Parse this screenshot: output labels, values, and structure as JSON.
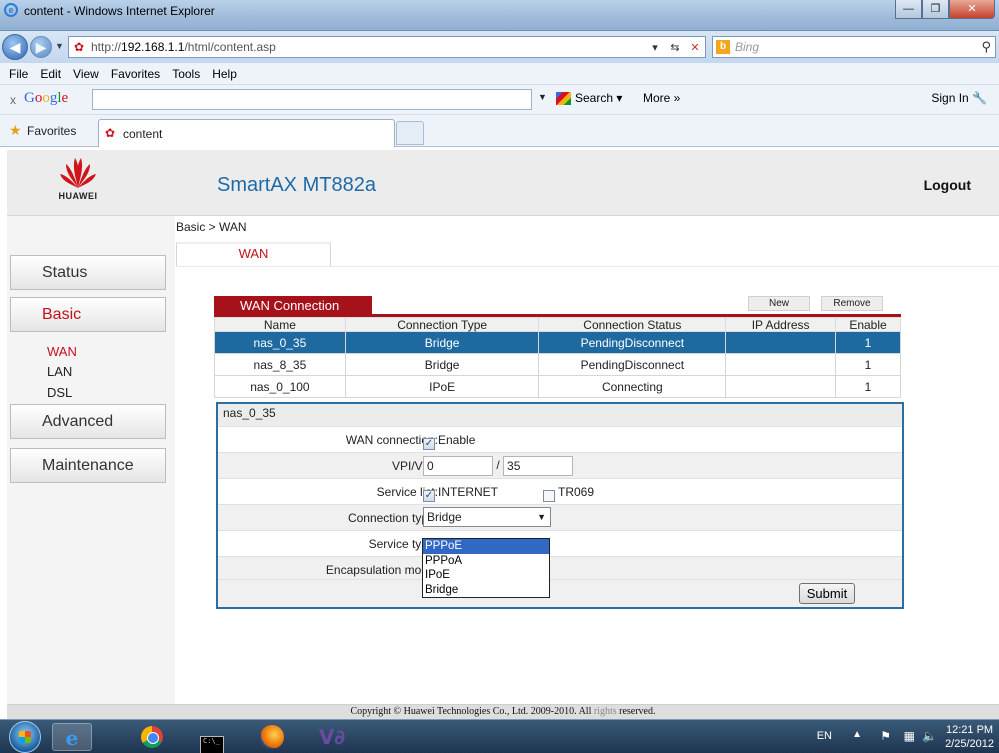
{
  "window": {
    "title": "content - Windows Internet Explorer"
  },
  "address": {
    "url_prefix": "http://",
    "url_host": "192.168.1.1",
    "url_path": "/html/content.asp",
    "search_placeholder": "Bing"
  },
  "menu": [
    "File",
    "Edit",
    "View",
    "Favorites",
    "Tools",
    "Help"
  ],
  "google_bar": {
    "close": "x",
    "search_label": "Search",
    "more_label": "More »",
    "sign_in": "Sign In"
  },
  "favorites_bar": {
    "favorites_label": "Favorites",
    "tab_label": "content"
  },
  "header": {
    "brand": "HUAWEI",
    "product": "SmartAX MT882a",
    "logout": "Logout"
  },
  "sidebar": {
    "status": "Status",
    "basic": "Basic",
    "basic_items": [
      "WAN",
      "LAN",
      "DSL"
    ],
    "advanced": "Advanced",
    "maintenance": "Maintenance"
  },
  "breadcrumb": "Basic > WAN",
  "tab": "WAN",
  "wan_table": {
    "title": "WAN Connection",
    "new_label": "New",
    "remove_label": "Remove",
    "columns": [
      "Name",
      "Connection Type",
      "Connection Status",
      "IP Address",
      "Enable"
    ],
    "rows": [
      [
        "nas_0_35",
        "Bridge",
        "PendingDisconnect",
        "",
        "1"
      ],
      [
        "nas_8_35",
        "Bridge",
        "PendingDisconnect",
        "",
        "1"
      ],
      [
        "nas_0_100",
        "IPoE",
        "Connecting",
        "",
        "1"
      ]
    ]
  },
  "detail": {
    "name": "nas_0_35",
    "wan_connection_label": "WAN connection:",
    "enable_label": "Enable",
    "vpi_vci_label": "VPI/VCI:",
    "vpi": "0",
    "slash": "/",
    "vci": "35",
    "service_list_label": "Service list:",
    "service_internet": "INTERNET",
    "service_tr069": "TR069",
    "connection_type_label": "Connection type:",
    "connection_type_value": "Bridge",
    "connection_type_options": [
      "PPPoE",
      "PPPoA",
      "IPoE",
      "Bridge"
    ],
    "service_type_label": "Service type:",
    "encapsulation_label": "Encapsulation mode:",
    "submit_label": "Submit"
  },
  "footer": {
    "copyright": "Copyright © Huawei Technologies Co., Ltd. 2009-2010. All ",
    "rights": "rights",
    "reserved": " reserved."
  },
  "taskbar": {
    "lang": "EN",
    "time": "12:21 PM",
    "date": "2/25/2012"
  },
  "colors": {
    "accent_red": "#a6121a",
    "selected_row": "#1e6aa0",
    "product_blue": "#1e6aa8"
  }
}
